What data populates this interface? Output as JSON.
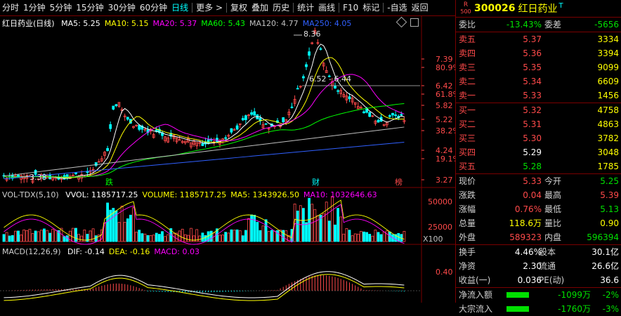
{
  "toolbar": {
    "items": [
      "分时",
      "1分钟",
      "5分钟",
      "15分钟",
      "30分钟",
      "60分钟",
      "日线",
      "更多 >",
      "复权",
      "叠加",
      "历史",
      "统计",
      "画线",
      "F10",
      "标记",
      "-自选",
      "返回"
    ],
    "active_index": 6
  },
  "main_panel": {
    "title": "红日药业(日线)",
    "ma": [
      {
        "label": "MA5: 5.25",
        "color": "#ffffff"
      },
      {
        "label": "MA10: 5.15",
        "color": "#ffff00"
      },
      {
        "label": "MA20: 5.37",
        "color": "#ff00ff"
      },
      {
        "label": "MA60: 5.43",
        "color": "#00ff00"
      },
      {
        "label": "MA120: 4.77",
        "color": "#c0c0c0"
      },
      {
        "label": "MA250: 4.05",
        "color": "#3060ff"
      }
    ],
    "price_labels": [
      "7.39",
      "80.9%",
      "6.42",
      "61.8%",
      "5.82",
      "5.22",
      "38.2%",
      "4.24",
      "19.1%",
      "3.27"
    ],
    "annotations": {
      "high": "8.36",
      "low": "3.38",
      "fib": "6.52 - 6.44",
      "die": "跌",
      "cai": "财",
      "rang": "榜"
    }
  },
  "vol_panel": {
    "title": "VOL-TDX(5,10)",
    "items": [
      {
        "label": "VVOL: 1185717.25",
        "color": "#ffffff"
      },
      {
        "label": "VOLUME: 1185717.25",
        "color": "#ffff00"
      },
      {
        "label": "MA5: 1343926.50",
        "color": "#ffff00"
      },
      {
        "label": "MA10: 1032646.63",
        "color": "#ff00ff"
      }
    ],
    "axis": [
      "50000",
      "25000",
      "X100"
    ]
  },
  "macd_panel": {
    "title": "MACD(12,26,9)",
    "items": [
      {
        "label": "DIF: -0.14",
        "color": "#ffffff"
      },
      {
        "label": "DEA: -0.16",
        "color": "#ffff00"
      },
      {
        "label": "MACD: 0.03",
        "color": "#ff00ff"
      }
    ],
    "axis": [
      "0.40"
    ]
  },
  "quote": {
    "code": "300026",
    "name": "红日药业",
    "badge_top": "R",
    "badge_bottom": "500",
    "t_mark": "T",
    "webi": {
      "label": "委比",
      "value": "-13.43%",
      "label2": "委差",
      "value2": "-5656"
    },
    "asks": [
      {
        "label": "卖五",
        "price": "5.37",
        "vol": "3334"
      },
      {
        "label": "卖四",
        "price": "5.36",
        "vol": "3394"
      },
      {
        "label": "卖三",
        "price": "5.35",
        "vol": "9099"
      },
      {
        "label": "卖二",
        "price": "5.34",
        "vol": "6609"
      },
      {
        "label": "卖一",
        "price": "5.33",
        "vol": "1456"
      }
    ],
    "bids": [
      {
        "label": "买一",
        "price": "5.32",
        "vol": "4758"
      },
      {
        "label": "买二",
        "price": "5.31",
        "vol": "4863"
      },
      {
        "label": "买三",
        "price": "5.30",
        "vol": "3782"
      },
      {
        "label": "买四",
        "price": "5.29",
        "vol": "3048"
      },
      {
        "label": "买五",
        "price": "5.28",
        "vol": "1785"
      }
    ],
    "stats": [
      {
        "l1": "现价",
        "v1": "5.33",
        "l2": "今开",
        "v2": "5.25"
      },
      {
        "l1": "涨跌",
        "v1": "0.04",
        "l2": "最高",
        "v2": "5.39"
      },
      {
        "l1": "涨幅",
        "v1": "0.76%",
        "l2": "最低",
        "v2": "5.13"
      },
      {
        "l1": "总量",
        "v1": "118.6万",
        "l2": "量比",
        "v2": "0.90"
      },
      {
        "l1": "外盘",
        "v1": "589323",
        "l2": "内盘",
        "v2": "596394"
      }
    ],
    "stats2": [
      {
        "l1": "换手",
        "v1": "4.46%",
        "l2": "股本",
        "v2": "30.1亿"
      },
      {
        "l1": "净资",
        "v1": "2.30",
        "l2": "流通",
        "v2": "26.6亿"
      },
      {
        "l1": "收益(一)",
        "v1": "0.036",
        "l2": "PE(动)",
        "v2": "36.6"
      }
    ],
    "flows": [
      {
        "label": "净流入额",
        "value": "-1099万",
        "pct": "-2%"
      },
      {
        "label": "大宗流入",
        "value": "-1760万",
        "pct": "-3%"
      }
    ]
  },
  "colors": {
    "up": "#ff4a4a",
    "down": "#00ffff",
    "ma5": "#ffffff",
    "ma10": "#ffff00",
    "ma20": "#ff00ff",
    "ma60": "#00ff00",
    "ma120": "#c0c0c0",
    "ma250": "#3060ff",
    "border": "#7a0000"
  }
}
